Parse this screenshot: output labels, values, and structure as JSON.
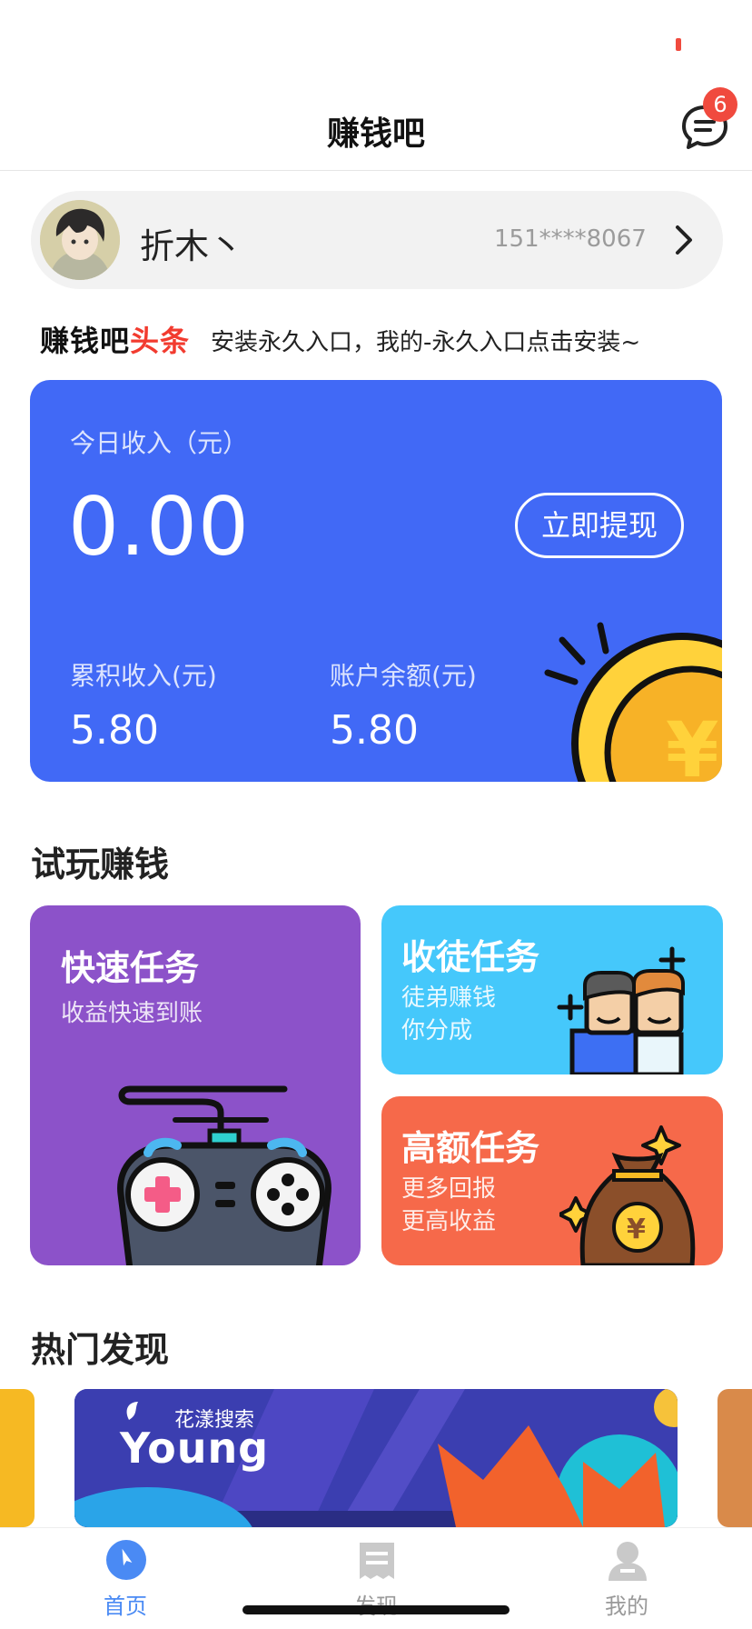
{
  "nav": {
    "title": "赚钱吧",
    "message_badge": "6"
  },
  "user": {
    "name": "折木丶",
    "phone": "151****8067"
  },
  "news": {
    "brand_main": "赚钱吧",
    "brand_highlight": "头条",
    "text": "安装永久入口，我的-永久入口点击安装~"
  },
  "earnings": {
    "today_label": "今日收入（元）",
    "today_value": "0.00",
    "withdraw_label": "立即提现",
    "total_label": "累积收入(元)",
    "total_value": "5.80",
    "balance_label": "账户余额(元)",
    "balance_value": "5.80"
  },
  "sections": {
    "trial": "试玩赚钱",
    "hot": "热门发现"
  },
  "tasks": {
    "quick": {
      "title": "快速任务",
      "subtitle": "收益快速到账"
    },
    "invite": {
      "title": "收徒任务",
      "line1": "徒弟赚钱",
      "line2": "你分成"
    },
    "high": {
      "title": "高额任务",
      "line1": "更多回报",
      "line2": "更高收益"
    }
  },
  "banner": {
    "brand_small": "花漾搜索",
    "brand_big": "Young"
  },
  "tabs": [
    {
      "label": "首页",
      "icon": "compass-icon",
      "active": true
    },
    {
      "label": "发现",
      "icon": "receipt-icon",
      "active": false
    },
    {
      "label": "我的",
      "icon": "person-icon",
      "active": false
    }
  ],
  "colors": {
    "accent_blue": "#4169f6",
    "quick_purple": "#8c52c9",
    "invite_cyan": "#45c8fb",
    "high_orange": "#f6694a",
    "badge_red": "#f04a3e",
    "tab_active": "#4a8af4"
  }
}
